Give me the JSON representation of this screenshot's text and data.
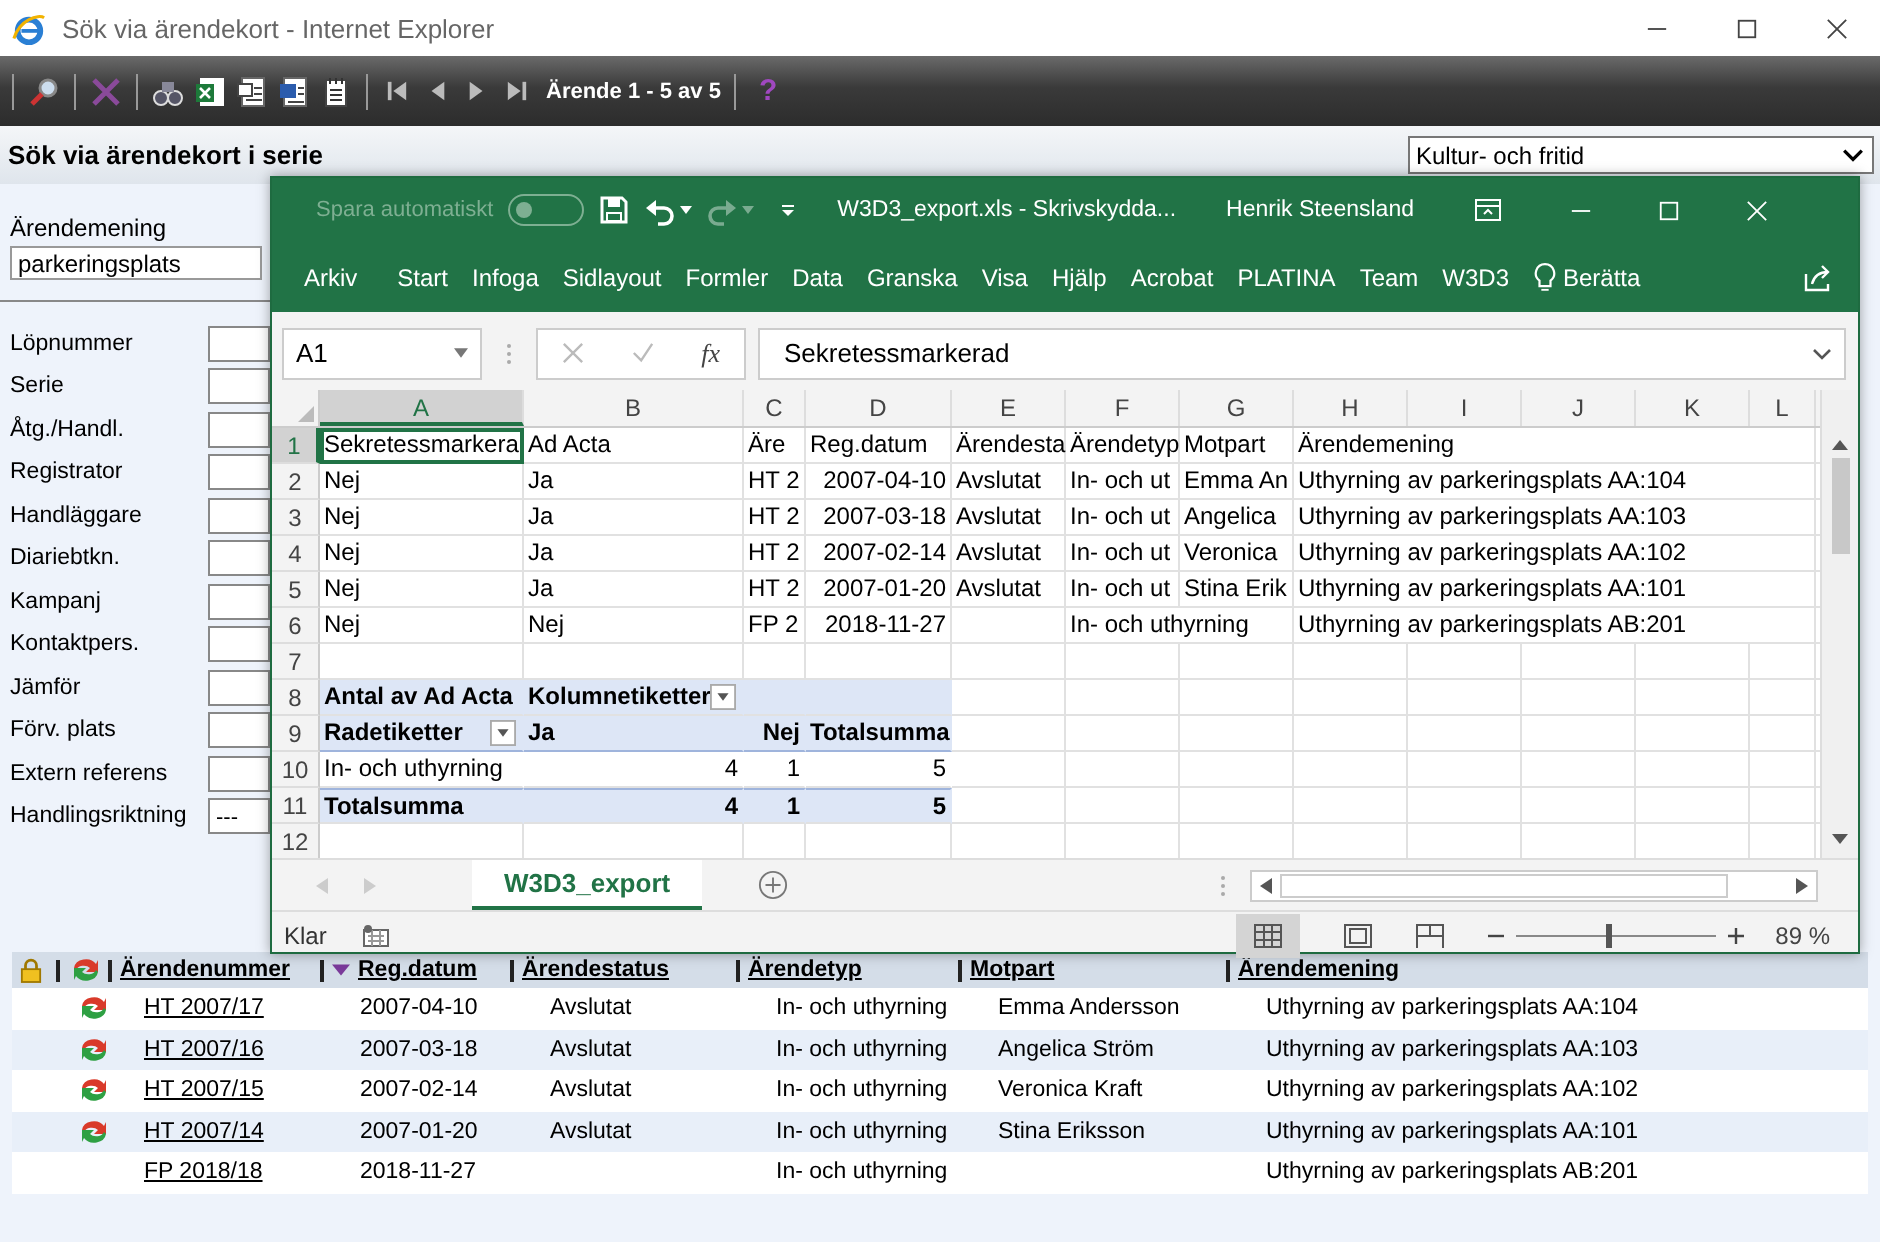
{
  "browser": {
    "title": "Sök via ärendekort - Internet Explorer"
  },
  "toolbar": {
    "record_counter": "Ärende 1 - 5 av 5",
    "help": "?"
  },
  "page": {
    "heading": "Sök via ärendekort i serie",
    "department": "Kultur- och fritid",
    "subject": {
      "label": "Ärendemening",
      "value": "parkeringsplats"
    },
    "fields": [
      {
        "label": "Löpnummer"
      },
      {
        "label": "Serie"
      },
      {
        "label": "Åtg./Handl."
      },
      {
        "label": "Registrator"
      },
      {
        "label": "Handläggare"
      },
      {
        "label": "Diariebtkn."
      },
      {
        "label": "Kampanj"
      },
      {
        "label": "Kontaktpers."
      },
      {
        "label": "Jämför"
      },
      {
        "label": "Förv. plats"
      },
      {
        "label": "Extern referens"
      },
      {
        "label": "Handlingsriktning",
        "value": "---"
      }
    ]
  },
  "results": {
    "columns": [
      {
        "label": "Ärendenummer",
        "sorted": false
      },
      {
        "label": "Reg.datum",
        "sorted": true
      },
      {
        "label": "Ärendestatus",
        "sorted": false
      },
      {
        "label": "Ärendetyp",
        "sorted": false
      },
      {
        "label": "Motpart",
        "sorted": false
      },
      {
        "label": "Ärendemening",
        "sorted": false
      }
    ],
    "rows": [
      {
        "status_icon": true,
        "cells": [
          "HT 2007/17",
          "2007-04-10",
          "Avslutat",
          "In- och uthyrning",
          "Emma Andersson",
          "Uthyrning av parkeringsplats AA:104"
        ]
      },
      {
        "status_icon": true,
        "cells": [
          "HT 2007/16",
          "2007-03-18",
          "Avslutat",
          "In- och uthyrning",
          "Angelica Ström",
          "Uthyrning av parkeringsplats AA:103"
        ]
      },
      {
        "status_icon": true,
        "cells": [
          "HT 2007/15",
          "2007-02-14",
          "Avslutat",
          "In- och uthyrning",
          "Veronica Kraft",
          "Uthyrning av parkeringsplats AA:102"
        ]
      },
      {
        "status_icon": true,
        "cells": [
          "HT 2007/14",
          "2007-01-20",
          "Avslutat",
          "In- och uthyrning",
          "Stina Eriksson",
          "Uthyrning av parkeringsplats AA:101"
        ]
      },
      {
        "status_icon": false,
        "cells": [
          "FP 2018/18",
          "2018-11-27",
          null,
          "In- och uthyrning",
          null,
          "Uthyrning av parkeringsplats AB:201"
        ]
      }
    ]
  },
  "excel": {
    "autosave": {
      "label": "Spara automatiskt",
      "on": false
    },
    "title": "W3D3_export.xls  -  Skrivskydda...",
    "user": "Henrik Steensland",
    "ribbon_tabs": [
      "Arkiv",
      "Start",
      "Infoga",
      "Sidlayout",
      "Formler",
      "Data",
      "Granska",
      "Visa",
      "Hjälp",
      "Acrobat",
      "PLATINA",
      "Team",
      "W3D3"
    ],
    "tell_me": "Berätta",
    "name_box": "A1",
    "fx": "fx",
    "formula": "Sekretessmarkerad",
    "columns": [
      {
        "label": "A",
        "selected": true
      },
      {
        "label": "B",
        "selected": false
      },
      {
        "label": "C",
        "selected": false
      },
      {
        "label": "D",
        "selected": false
      },
      {
        "label": "E",
        "selected": false
      },
      {
        "label": "F",
        "selected": false
      },
      {
        "label": "G",
        "selected": false
      },
      {
        "label": "H",
        "selected": false
      },
      {
        "label": "I",
        "selected": false
      },
      {
        "label": "J",
        "selected": false
      },
      {
        "label": "K",
        "selected": false
      },
      {
        "label": "L",
        "selected": false
      }
    ],
    "rows": [
      {
        "number": "1",
        "selected": true,
        "kind": "data",
        "cells": [
          "Sekretessmarkera",
          "Ad Acta",
          "Äre",
          "Reg.datum",
          "Ärendesta",
          "Ärendetyp",
          "Motpart",
          "Ärendemening"
        ]
      },
      {
        "number": "2",
        "selected": false,
        "kind": "data",
        "cells": [
          "Nej",
          "Ja",
          "HT 2",
          "2007-04-10",
          "Avslutat",
          "In- och ut",
          "Emma An",
          "Uthyrning av parkeringsplats AA:104"
        ]
      },
      {
        "number": "3",
        "selected": false,
        "kind": "data",
        "cells": [
          "Nej",
          "Ja",
          "HT 2",
          "2007-03-18",
          "Avslutat",
          "In- och ut",
          "Angelica",
          "Uthyrning av parkeringsplats AA:103"
        ]
      },
      {
        "number": "4",
        "selected": false,
        "kind": "data",
        "cells": [
          "Nej",
          "Ja",
          "HT 2",
          "2007-02-14",
          "Avslutat",
          "In- och ut",
          "Veronica",
          "Uthyrning av parkeringsplats AA:102"
        ]
      },
      {
        "number": "5",
        "selected": false,
        "kind": "data",
        "cells": [
          "Nej",
          "Ja",
          "HT 2",
          "2007-01-20",
          "Avslutat",
          "In- och ut",
          "Stina Erik",
          "Uthyrning av parkeringsplats AA:101"
        ]
      },
      {
        "number": "6",
        "selected": false,
        "kind": "data",
        "cells": [
          "Nej",
          "Nej",
          "FP 2",
          "2018-11-27",
          null,
          "In- och uthyrning",
          null,
          "Uthyrning av parkeringsplats AB:201"
        ]
      },
      {
        "number": "7",
        "selected": false,
        "kind": "data",
        "cells": []
      },
      {
        "number": "8",
        "selected": false,
        "kind": "pivot-header",
        "cells": [
          "Antal av Ad Acta",
          "Kolumnetiketter"
        ]
      },
      {
        "number": "9",
        "selected": false,
        "kind": "pivot-labels",
        "cells": [
          "Radetiketter",
          "Ja",
          "Nej",
          "Totalsumma"
        ]
      },
      {
        "number": "10",
        "selected": false,
        "kind": "pivot-row",
        "cells": [
          "In- och uthyrning",
          "4",
          "1",
          "5"
        ]
      },
      {
        "number": "11",
        "selected": false,
        "kind": "pivot-total",
        "cells": [
          "Totalsumma",
          "4",
          "1",
          "5"
        ]
      },
      {
        "number": "12",
        "selected": false,
        "kind": "data",
        "cells": []
      }
    ],
    "sheet_tabs": [
      {
        "label": "W3D3_export",
        "selected": true
      }
    ],
    "status": "Klar",
    "zoom": {
      "level": 0.45,
      "reading": "89 %"
    }
  }
}
